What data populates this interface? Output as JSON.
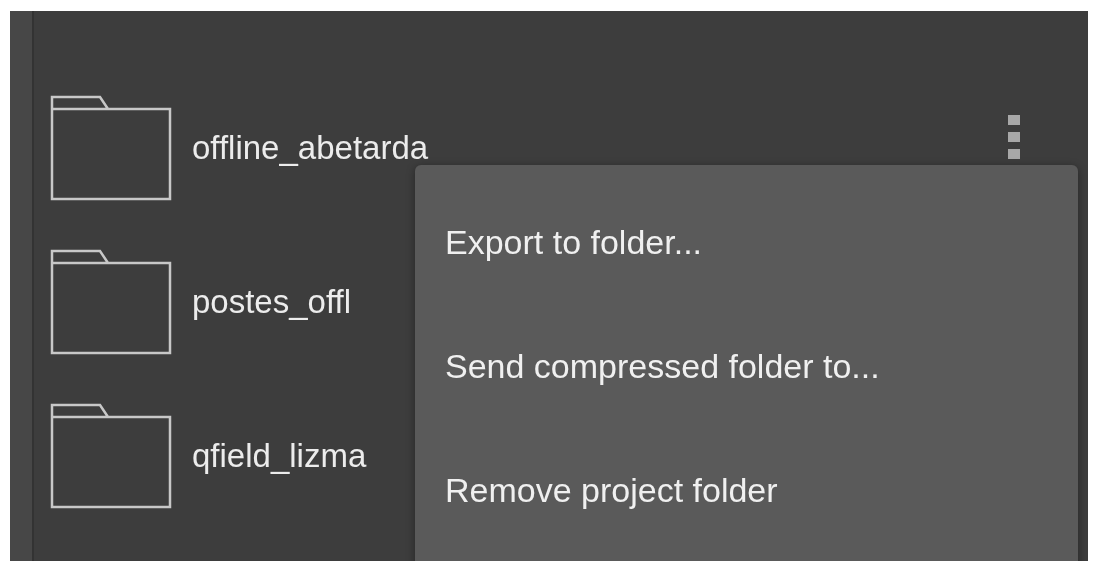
{
  "folders": [
    {
      "name": "offline_abetarda"
    },
    {
      "name": "postes_offl"
    },
    {
      "name": "qfield_lizma"
    }
  ],
  "menu": {
    "open": true,
    "items": [
      "Export to folder...",
      "Send compressed folder to...",
      "Remove project folder"
    ]
  }
}
